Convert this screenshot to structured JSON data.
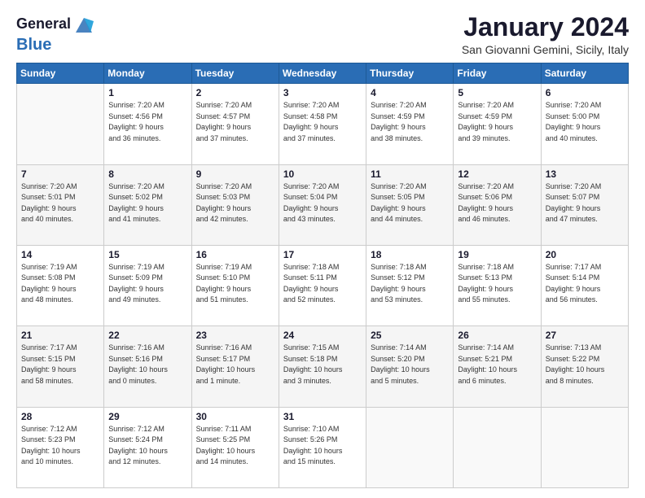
{
  "header": {
    "logo_line1": "General",
    "logo_line2": "Blue",
    "month_title": "January 2024",
    "location": "San Giovanni Gemini, Sicily, Italy"
  },
  "weekdays": [
    "Sunday",
    "Monday",
    "Tuesday",
    "Wednesday",
    "Thursday",
    "Friday",
    "Saturday"
  ],
  "weeks": [
    [
      {
        "day": "",
        "info": ""
      },
      {
        "day": "1",
        "info": "Sunrise: 7:20 AM\nSunset: 4:56 PM\nDaylight: 9 hours\nand 36 minutes."
      },
      {
        "day": "2",
        "info": "Sunrise: 7:20 AM\nSunset: 4:57 PM\nDaylight: 9 hours\nand 37 minutes."
      },
      {
        "day": "3",
        "info": "Sunrise: 7:20 AM\nSunset: 4:58 PM\nDaylight: 9 hours\nand 37 minutes."
      },
      {
        "day": "4",
        "info": "Sunrise: 7:20 AM\nSunset: 4:59 PM\nDaylight: 9 hours\nand 38 minutes."
      },
      {
        "day": "5",
        "info": "Sunrise: 7:20 AM\nSunset: 4:59 PM\nDaylight: 9 hours\nand 39 minutes."
      },
      {
        "day": "6",
        "info": "Sunrise: 7:20 AM\nSunset: 5:00 PM\nDaylight: 9 hours\nand 40 minutes."
      }
    ],
    [
      {
        "day": "7",
        "info": "Sunrise: 7:20 AM\nSunset: 5:01 PM\nDaylight: 9 hours\nand 40 minutes."
      },
      {
        "day": "8",
        "info": "Sunrise: 7:20 AM\nSunset: 5:02 PM\nDaylight: 9 hours\nand 41 minutes."
      },
      {
        "day": "9",
        "info": "Sunrise: 7:20 AM\nSunset: 5:03 PM\nDaylight: 9 hours\nand 42 minutes."
      },
      {
        "day": "10",
        "info": "Sunrise: 7:20 AM\nSunset: 5:04 PM\nDaylight: 9 hours\nand 43 minutes."
      },
      {
        "day": "11",
        "info": "Sunrise: 7:20 AM\nSunset: 5:05 PM\nDaylight: 9 hours\nand 44 minutes."
      },
      {
        "day": "12",
        "info": "Sunrise: 7:20 AM\nSunset: 5:06 PM\nDaylight: 9 hours\nand 46 minutes."
      },
      {
        "day": "13",
        "info": "Sunrise: 7:20 AM\nSunset: 5:07 PM\nDaylight: 9 hours\nand 47 minutes."
      }
    ],
    [
      {
        "day": "14",
        "info": "Sunrise: 7:19 AM\nSunset: 5:08 PM\nDaylight: 9 hours\nand 48 minutes."
      },
      {
        "day": "15",
        "info": "Sunrise: 7:19 AM\nSunset: 5:09 PM\nDaylight: 9 hours\nand 49 minutes."
      },
      {
        "day": "16",
        "info": "Sunrise: 7:19 AM\nSunset: 5:10 PM\nDaylight: 9 hours\nand 51 minutes."
      },
      {
        "day": "17",
        "info": "Sunrise: 7:18 AM\nSunset: 5:11 PM\nDaylight: 9 hours\nand 52 minutes."
      },
      {
        "day": "18",
        "info": "Sunrise: 7:18 AM\nSunset: 5:12 PM\nDaylight: 9 hours\nand 53 minutes."
      },
      {
        "day": "19",
        "info": "Sunrise: 7:18 AM\nSunset: 5:13 PM\nDaylight: 9 hours\nand 55 minutes."
      },
      {
        "day": "20",
        "info": "Sunrise: 7:17 AM\nSunset: 5:14 PM\nDaylight: 9 hours\nand 56 minutes."
      }
    ],
    [
      {
        "day": "21",
        "info": "Sunrise: 7:17 AM\nSunset: 5:15 PM\nDaylight: 9 hours\nand 58 minutes."
      },
      {
        "day": "22",
        "info": "Sunrise: 7:16 AM\nSunset: 5:16 PM\nDaylight: 10 hours\nand 0 minutes."
      },
      {
        "day": "23",
        "info": "Sunrise: 7:16 AM\nSunset: 5:17 PM\nDaylight: 10 hours\nand 1 minute."
      },
      {
        "day": "24",
        "info": "Sunrise: 7:15 AM\nSunset: 5:18 PM\nDaylight: 10 hours\nand 3 minutes."
      },
      {
        "day": "25",
        "info": "Sunrise: 7:14 AM\nSunset: 5:20 PM\nDaylight: 10 hours\nand 5 minutes."
      },
      {
        "day": "26",
        "info": "Sunrise: 7:14 AM\nSunset: 5:21 PM\nDaylight: 10 hours\nand 6 minutes."
      },
      {
        "day": "27",
        "info": "Sunrise: 7:13 AM\nSunset: 5:22 PM\nDaylight: 10 hours\nand 8 minutes."
      }
    ],
    [
      {
        "day": "28",
        "info": "Sunrise: 7:12 AM\nSunset: 5:23 PM\nDaylight: 10 hours\nand 10 minutes."
      },
      {
        "day": "29",
        "info": "Sunrise: 7:12 AM\nSunset: 5:24 PM\nDaylight: 10 hours\nand 12 minutes."
      },
      {
        "day": "30",
        "info": "Sunrise: 7:11 AM\nSunset: 5:25 PM\nDaylight: 10 hours\nand 14 minutes."
      },
      {
        "day": "31",
        "info": "Sunrise: 7:10 AM\nSunset: 5:26 PM\nDaylight: 10 hours\nand 15 minutes."
      },
      {
        "day": "",
        "info": ""
      },
      {
        "day": "",
        "info": ""
      },
      {
        "day": "",
        "info": ""
      }
    ]
  ]
}
